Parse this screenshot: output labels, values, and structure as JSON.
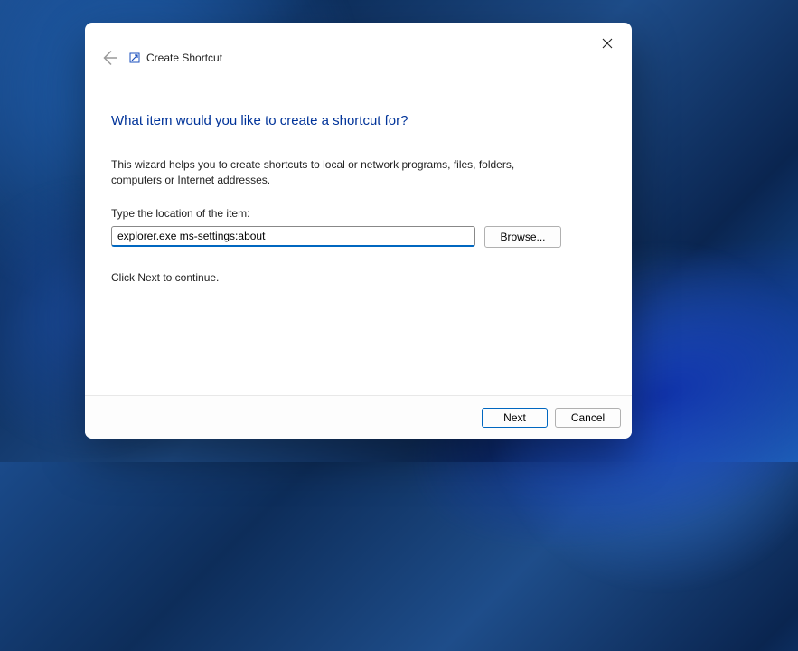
{
  "window": {
    "title": "Create Shortcut"
  },
  "content": {
    "heading": "What item would you like to create a shortcut for?",
    "description": "This wizard helps you to create shortcuts to local or network programs, files, folders, computers or Internet addresses.",
    "field_label": "Type the location of the item:",
    "location_value": "explorer.exe ms-settings:about",
    "browse_label": "Browse...",
    "continue_hint": "Click Next to continue."
  },
  "footer": {
    "next_label": "Next",
    "cancel_label": "Cancel"
  }
}
